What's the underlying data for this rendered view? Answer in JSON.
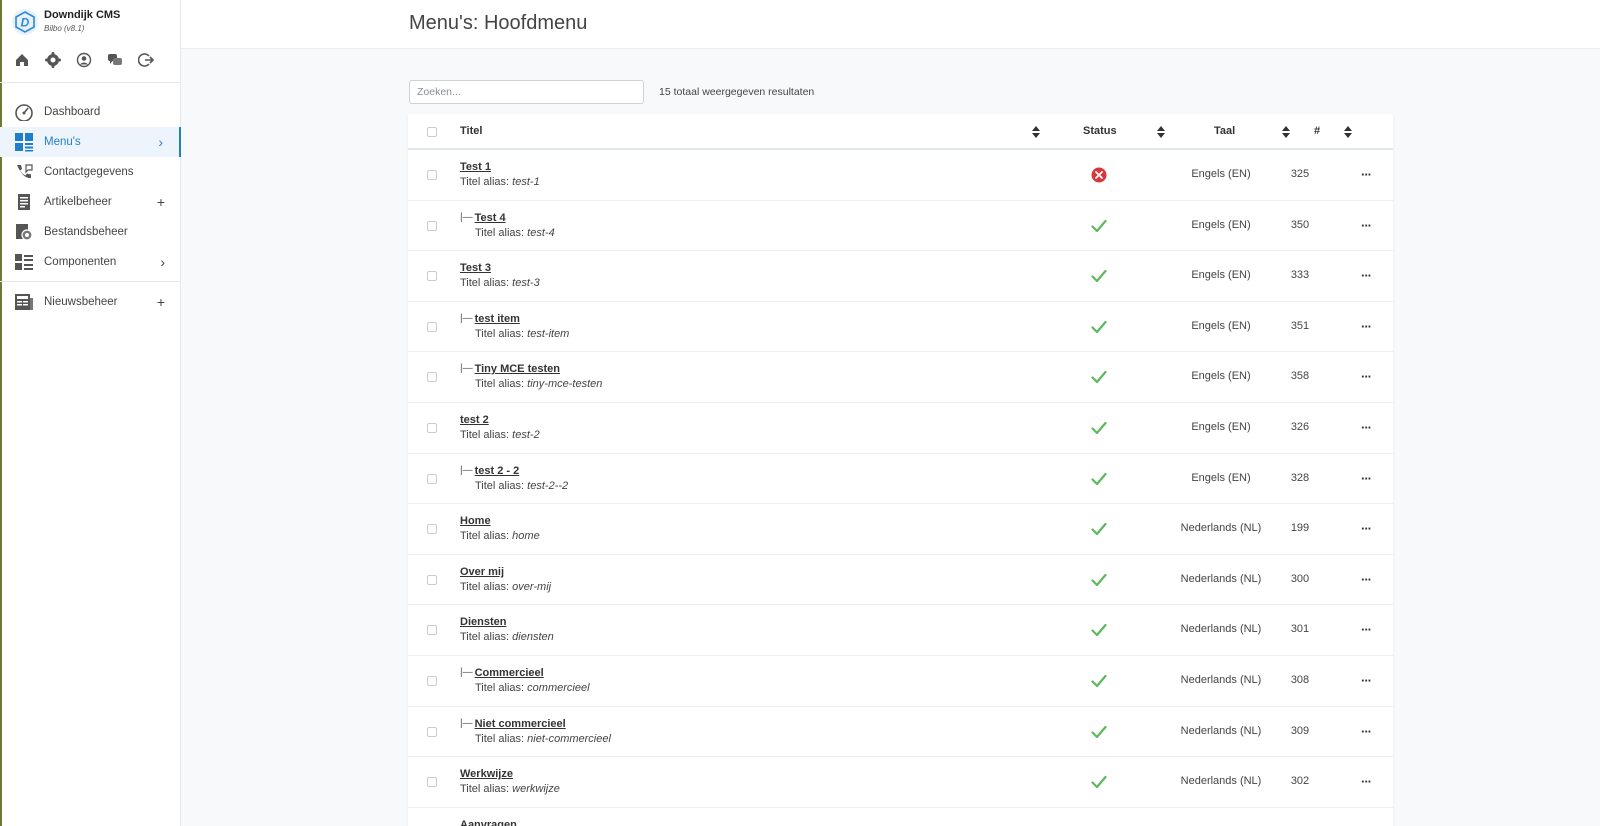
{
  "brand": {
    "title": "Downdijk CMS",
    "version": "Bilbo (v8.1)",
    "logo_letter": "D"
  },
  "quick_icons": [
    "home-icon",
    "settings-badge-icon",
    "user-icon",
    "chat-icon",
    "logout-icon"
  ],
  "nav": [
    {
      "label": "Dashboard",
      "icon": "dashboard-icon",
      "trail": ""
    },
    {
      "label": "Menu's",
      "icon": "menus-icon",
      "trail": "›",
      "active": true
    },
    {
      "label": "Contactgegevens",
      "icon": "phone-icon",
      "trail": ""
    },
    {
      "label": "Artikelbeheer",
      "icon": "articles-icon",
      "trail": "+"
    },
    {
      "label": "Bestandsbeheer",
      "icon": "files-icon",
      "trail": ""
    },
    {
      "label": "Componenten",
      "icon": "components-icon",
      "trail": "›"
    },
    {
      "label": "Nieuwsbeheer",
      "icon": "news-icon",
      "trail": "+"
    }
  ],
  "page": {
    "title": "Menu's: Hoofdmenu"
  },
  "search": {
    "placeholder": "Zoeken...",
    "value": ""
  },
  "result_count": "15 totaal weergegeven resultaten",
  "table": {
    "columns": {
      "title": "Titel",
      "status": "Status",
      "language": "Taal",
      "id": "#"
    },
    "alias_label": "Titel alias:",
    "tree_marker": "|—",
    "more_label": "···",
    "colors": {
      "published": "#5cb85c",
      "unpublished": "#d9363e"
    },
    "rows": [
      {
        "title": "Test 1",
        "alias": "test-1",
        "child": false,
        "status": "unpublished",
        "language": "Engels (EN)",
        "id": "325"
      },
      {
        "title": "Test 4",
        "alias": "test-4",
        "child": true,
        "status": "published",
        "language": "Engels (EN)",
        "id": "350"
      },
      {
        "title": "Test 3",
        "alias": "test-3",
        "child": false,
        "status": "published",
        "language": "Engels (EN)",
        "id": "333"
      },
      {
        "title": "test item",
        "alias": "test-item",
        "child": true,
        "status": "published",
        "language": "Engels (EN)",
        "id": "351"
      },
      {
        "title": "Tiny MCE testen",
        "alias": "tiny-mce-testen",
        "child": true,
        "status": "published",
        "language": "Engels (EN)",
        "id": "358"
      },
      {
        "title": "test 2",
        "alias": "test-2",
        "child": false,
        "status": "published",
        "language": "Engels (EN)",
        "id": "326"
      },
      {
        "title": "test 2 - 2",
        "alias": "test-2--2",
        "child": true,
        "status": "published",
        "language": "Engels (EN)",
        "id": "328"
      },
      {
        "title": "Home",
        "alias": "home",
        "child": false,
        "status": "published",
        "language": "Nederlands (NL)",
        "id": "199"
      },
      {
        "title": "Over mij",
        "alias": "over-mij",
        "child": false,
        "status": "published",
        "language": "Nederlands (NL)",
        "id": "300"
      },
      {
        "title": "Diensten",
        "alias": "diensten",
        "child": false,
        "status": "published",
        "language": "Nederlands (NL)",
        "id": "301"
      },
      {
        "title": "Commercieel",
        "alias": "commercieel",
        "child": true,
        "status": "published",
        "language": "Nederlands (NL)",
        "id": "308"
      },
      {
        "title": "Niet commercieel",
        "alias": "niet-commercieel",
        "child": true,
        "status": "published",
        "language": "Nederlands (NL)",
        "id": "309"
      },
      {
        "title": "Werkwijze",
        "alias": "werkwijze",
        "child": false,
        "status": "published",
        "language": "Nederlands (NL)",
        "id": "302"
      },
      {
        "title": "Aanvragen",
        "alias": "",
        "child": false,
        "status": "",
        "language": "",
        "id": ""
      }
    ]
  }
}
